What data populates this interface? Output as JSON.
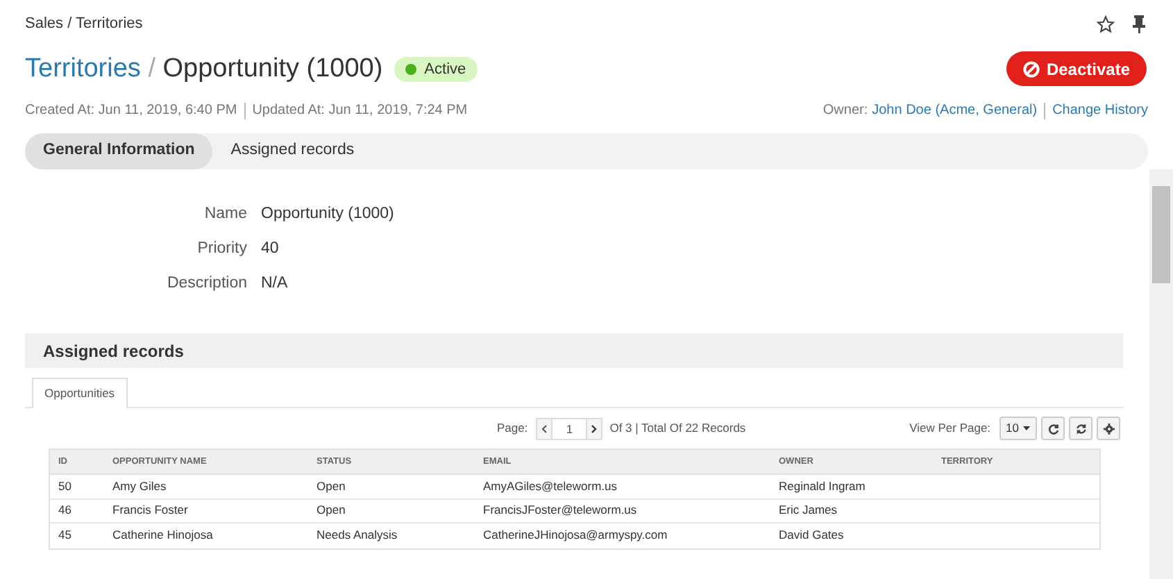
{
  "breadcrumb": "Sales / Territories",
  "title": {
    "parent": "Territories",
    "separator": "/",
    "name": "Opportunity (1000)"
  },
  "status_badge": {
    "label": "Active",
    "color": "#4caf1e"
  },
  "deactivate_button": "Deactivate",
  "meta": {
    "created": "Created At: Jun 11, 2019, 6:40 PM",
    "updated": "Updated At: Jun 11, 2019, 7:24 PM",
    "owner_label": "Owner:",
    "owner": "John Doe (Acme, General)",
    "history_link": "Change History"
  },
  "tabs": [
    {
      "label": "General Information",
      "selected": true
    },
    {
      "label": "Assigned records",
      "selected": false
    }
  ],
  "fields": [
    {
      "label": "Name",
      "value": "Opportunity (1000)"
    },
    {
      "label": "Priority",
      "value": "40"
    },
    {
      "label": "Description",
      "value": "N/A"
    }
  ],
  "section_title": "Assigned records",
  "sub_tabs": [
    {
      "label": "Opportunities",
      "selected": true
    }
  ],
  "pager": {
    "label": "Page:",
    "page": "1",
    "total": "Of 3 | Total Of 22 Records",
    "per_page_label": "View Per Page:",
    "per_page": "10"
  },
  "table": {
    "columns": [
      "ID",
      "OPPORTUNITY NAME",
      "STATUS",
      "EMAIL",
      "OWNER",
      "TERRITORY"
    ],
    "rows": [
      [
        "50",
        "Amy Giles",
        "Open",
        "AmyAGiles@teleworm.us",
        "Reginald Ingram",
        ""
      ],
      [
        "46",
        "Francis Foster",
        "Open",
        "FrancisJFoster@teleworm.us",
        "Eric James",
        ""
      ],
      [
        "45",
        "Catherine Hinojosa",
        "Needs Analysis",
        "CatherineJHinojosa@armyspy.com",
        "David Gates",
        ""
      ]
    ]
  }
}
